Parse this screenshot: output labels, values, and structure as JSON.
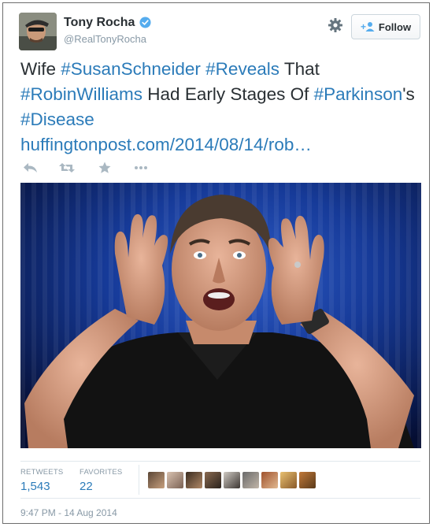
{
  "author": {
    "display_name": "Tony Rocha",
    "handle": "@RealTonyRocha",
    "verified": true
  },
  "header": {
    "follow_label": "Follow",
    "accent_color": "#2b7bb9"
  },
  "tweet": {
    "parts": [
      {
        "text": "Wife ",
        "type": "text"
      },
      {
        "text": "#SusanSchneider",
        "type": "hashtag"
      },
      {
        "text": " ",
        "type": "text"
      },
      {
        "text": "#Reveals",
        "type": "hashtag"
      },
      {
        "text": " That ",
        "type": "text"
      },
      {
        "text": "#RobinWilliams",
        "type": "hashtag"
      },
      {
        "text": " Had Early Stages Of ",
        "type": "text"
      },
      {
        "text": "#Parkinson",
        "type": "hashtag"
      },
      {
        "text": "'s ",
        "type": "text"
      },
      {
        "text": "#Disease",
        "type": "hashtag"
      }
    ],
    "link": "huffingtonpost.com/2014/08/14/rob…"
  },
  "actions": {
    "icons": [
      "reply-icon",
      "retweet-icon",
      "favorite-icon",
      "more-icon"
    ]
  },
  "stats": {
    "retweets_label": "RETWEETS",
    "retweets_value": "1,543",
    "favorites_label": "FAVORITES",
    "favorites_value": "22",
    "favoriter_avatars": 8
  },
  "timestamp": "9:47 PM - 14 Aug 2014"
}
